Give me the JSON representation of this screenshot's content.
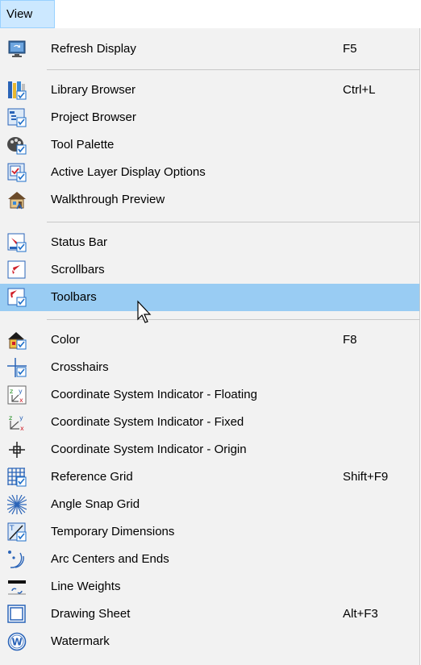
{
  "menubar": {
    "view_label": "View"
  },
  "menu": {
    "items": [
      {
        "label": "Refresh Display",
        "shortcut": "F5",
        "icon": "refresh-display-icon"
      },
      {
        "label": "Library Browser",
        "shortcut": "Ctrl+L",
        "icon": "library-browser-icon"
      },
      {
        "label": "Project Browser",
        "shortcut": "",
        "icon": "project-browser-icon"
      },
      {
        "label": "Tool Palette",
        "shortcut": "",
        "icon": "tool-palette-icon"
      },
      {
        "label": "Active Layer Display Options",
        "shortcut": "",
        "icon": "layer-display-icon"
      },
      {
        "label": "Walkthrough Preview",
        "shortcut": "",
        "icon": "walkthrough-icon"
      },
      {
        "label": "Status Bar",
        "shortcut": "",
        "icon": "status-bar-icon"
      },
      {
        "label": "Scrollbars",
        "shortcut": "",
        "icon": "scrollbars-icon"
      },
      {
        "label": "Toolbars",
        "shortcut": "",
        "icon": "toolbars-icon",
        "highlighted": true
      },
      {
        "label": "Color",
        "shortcut": "F8",
        "icon": "color-icon"
      },
      {
        "label": "Crosshairs",
        "shortcut": "",
        "icon": "crosshairs-icon"
      },
      {
        "label": "Coordinate System Indicator - Floating",
        "shortcut": "",
        "icon": "coord-floating-icon"
      },
      {
        "label": "Coordinate System Indicator - Fixed",
        "shortcut": "",
        "icon": "coord-fixed-icon"
      },
      {
        "label": "Coordinate System Indicator - Origin",
        "shortcut": "",
        "icon": "coord-origin-icon"
      },
      {
        "label": "Reference Grid",
        "shortcut": "Shift+F9",
        "icon": "reference-grid-icon"
      },
      {
        "label": "Angle Snap Grid",
        "shortcut": "",
        "icon": "angle-snap-icon"
      },
      {
        "label": "Temporary Dimensions",
        "shortcut": "",
        "icon": "temp-dimensions-icon"
      },
      {
        "label": "Arc Centers and Ends",
        "shortcut": "",
        "icon": "arc-centers-icon"
      },
      {
        "label": "Line Weights",
        "shortcut": "",
        "icon": "line-weights-icon"
      },
      {
        "label": "Drawing Sheet",
        "shortcut": "Alt+F3",
        "icon": "drawing-sheet-icon"
      },
      {
        "label": "Watermark",
        "shortcut": "",
        "icon": "watermark-icon"
      }
    ]
  },
  "colors": {
    "highlight": "#99ccf3",
    "menu_bg": "#f2f2f2",
    "check_blue": "#1e6fc9",
    "accent_red": "#d0202a"
  }
}
